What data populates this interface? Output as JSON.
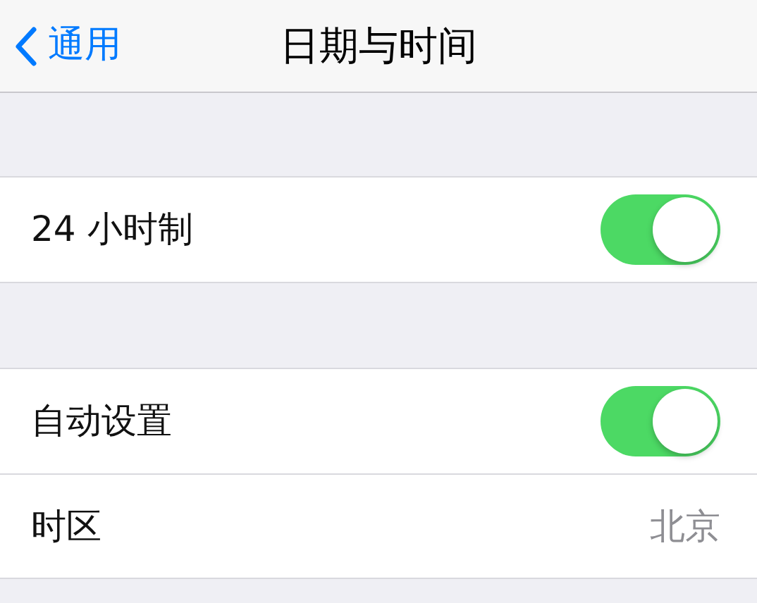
{
  "nav_bar": {
    "back_label": "通用",
    "title": "日期与时间"
  },
  "sections": [
    {
      "rows": [
        {
          "kind": "toggle",
          "label": "24 小时制",
          "on": true
        }
      ]
    },
    {
      "rows": [
        {
          "kind": "toggle",
          "label": "自动设置",
          "on": true
        },
        {
          "kind": "value",
          "label": "时区",
          "value": "北京"
        }
      ]
    }
  ]
}
